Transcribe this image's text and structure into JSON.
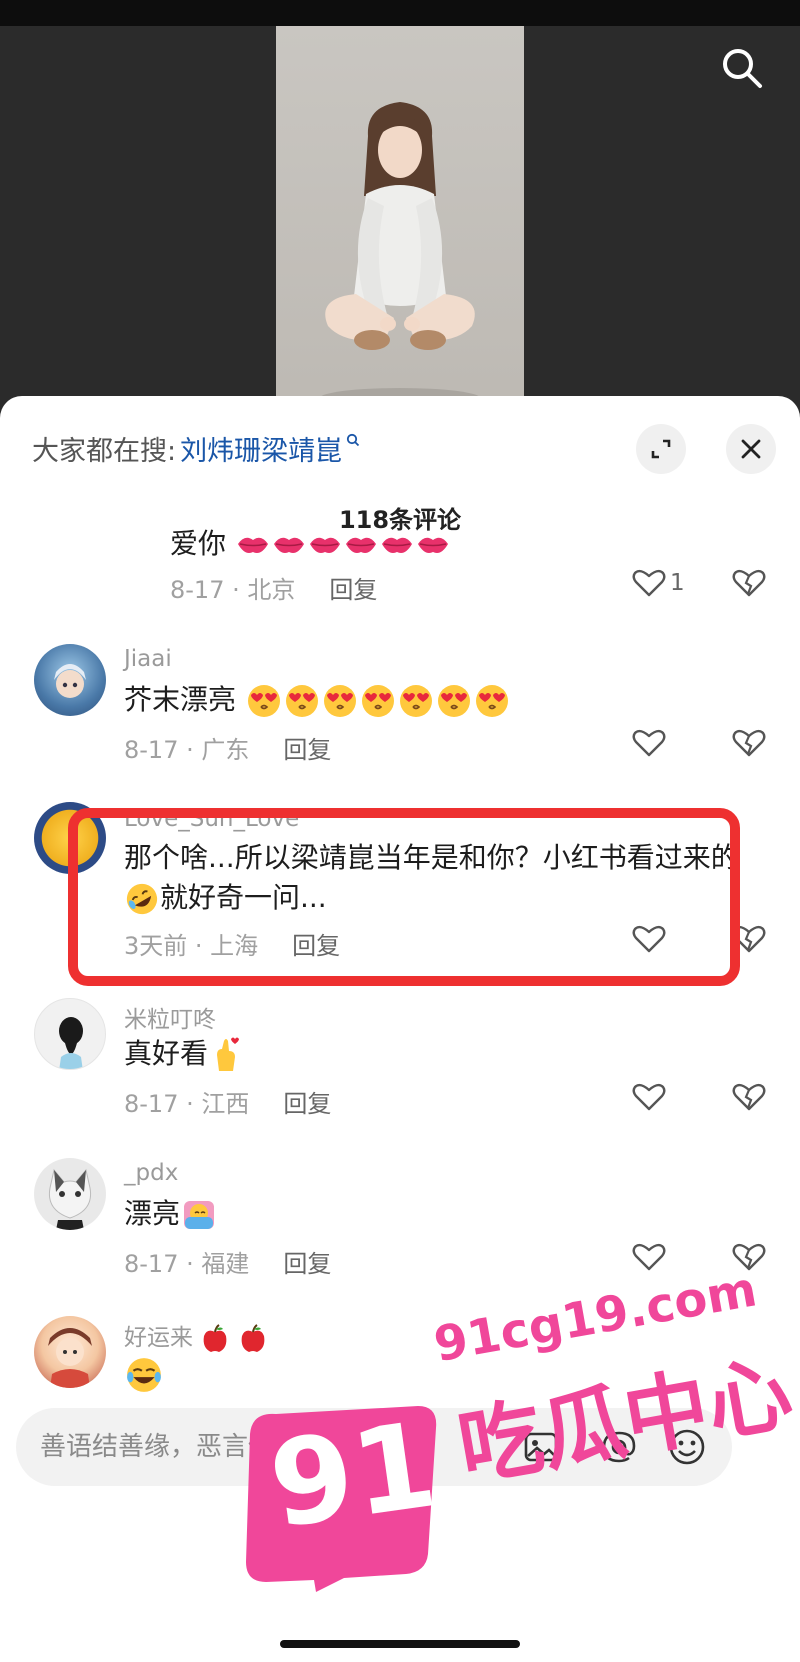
{
  "header": {
    "trending_label": "大家都在搜:",
    "trending_link": "刘炜珊梁靖崑"
  },
  "comments_count": "118条评论",
  "comments": [
    {
      "username": "",
      "text": "爱你",
      "emoji_names": [
        "kiss-lips-emoji",
        "kiss-lips-emoji",
        "kiss-lips-emoji",
        "kiss-lips-emoji",
        "kiss-lips-emoji",
        "kiss-lips-emoji"
      ],
      "date_location": "8-17 · 北京",
      "reply": "回复",
      "likes": "1"
    },
    {
      "username": "Jiaai",
      "text": "芥末漂亮",
      "emoji_names": [
        "heart-eyes-emoji",
        "heart-eyes-emoji",
        "heart-eyes-emoji",
        "heart-eyes-emoji",
        "heart-eyes-emoji",
        "heart-eyes-emoji",
        "heart-eyes-emoji"
      ],
      "date_location": "8-17 · 广东",
      "reply": "回复",
      "likes": ""
    },
    {
      "username": "Love_Sun_Love",
      "text_part1": "那个啥...所以梁靖崑当年是和你？小红书看过来的",
      "text_part2": "就好奇一问...",
      "emoji_names": [
        "rolling-laugh-emoji"
      ],
      "date_location": "3天前 · 上海",
      "reply": "回复",
      "likes": ""
    },
    {
      "username": "米粒叮咚",
      "text": "真好看",
      "emoji_names": [
        "finger-heart-emoji"
      ],
      "date_location": "8-17 · 江西",
      "reply": "回复",
      "likes": ""
    },
    {
      "username": "_pdx",
      "text": "漂亮",
      "emoji_names": [
        "hug-emoji"
      ],
      "date_location": "8-17 · 福建",
      "reply": "回复",
      "likes": ""
    },
    {
      "username": "好运来",
      "text": "",
      "emoji_names": [
        "tears-of-joy-emoji"
      ],
      "date_location": "",
      "reply": "",
      "likes": ""
    }
  ],
  "input": {
    "placeholder": "善语结善缘，恶言伤人心"
  },
  "watermark": {
    "url": "91cg19.com",
    "site_name": "吃瓜中心",
    "badge_number": "91"
  },
  "colors": {
    "link": "#1a56a8",
    "highlight_border": "#ee3030",
    "watermark": "#f0479a",
    "lips": "#e8316b",
    "emoji_face": "#ffc83d"
  }
}
